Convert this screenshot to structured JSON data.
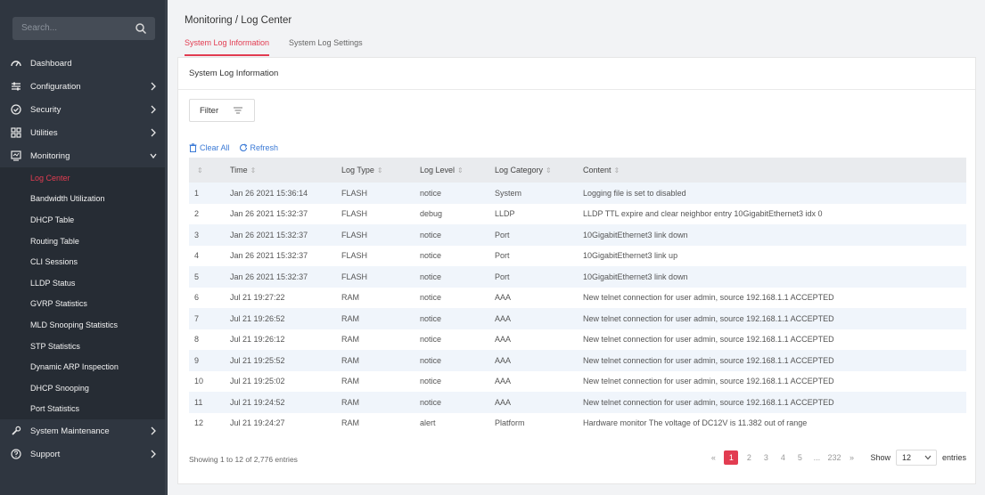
{
  "sidebar": {
    "search_placeholder": "Search...",
    "items": [
      {
        "label": "Dashboard",
        "icon": "dashboard-icon"
      },
      {
        "label": "Configuration",
        "icon": "sliders-icon"
      },
      {
        "label": "Security",
        "icon": "shield-icon"
      },
      {
        "label": "Utilities",
        "icon": "grid-icon"
      },
      {
        "label": "Monitoring",
        "icon": "monitor-icon"
      }
    ],
    "monitoring_sub": [
      "Log Center",
      "Bandwidth Utilization",
      "DHCP Table",
      "Routing Table",
      "CLI Sessions",
      "LLDP Status",
      "GVRP Statistics",
      "MLD Snooping Statistics",
      "STP Statistics",
      "Dynamic ARP Inspection",
      "DHCP Snooping",
      "Port Statistics"
    ],
    "bottom_items": [
      {
        "label": "System Maintenance",
        "icon": "wrench-icon"
      },
      {
        "label": "Support",
        "icon": "help-icon"
      }
    ]
  },
  "header": {
    "breadcrumb": "Monitoring / Log Center"
  },
  "tabs": [
    "System Log Information",
    "System Log Settings"
  ],
  "panel": {
    "title": "System Log Information",
    "filter_label": "Filter",
    "clear_all": "Clear All",
    "refresh": "Refresh"
  },
  "table": {
    "columns": [
      "",
      "Time",
      "Log Type",
      "Log Level",
      "Log Category",
      "Content"
    ],
    "rows": [
      [
        "1",
        "Jan 26 2021 15:36:14",
        "FLASH",
        "notice",
        "System",
        "Logging file is set to disabled"
      ],
      [
        "2",
        "Jan 26 2021 15:32:37",
        "FLASH",
        "debug",
        "LLDP",
        "LLDP TTL expire and clear neighbor entry 10GigabitEthernet3 idx 0"
      ],
      [
        "3",
        "Jan 26 2021 15:32:37",
        "FLASH",
        "notice",
        "Port",
        "10GigabitEthernet3 link down"
      ],
      [
        "4",
        "Jan 26 2021 15:32:37",
        "FLASH",
        "notice",
        "Port",
        "10GigabitEthernet3 link up"
      ],
      [
        "5",
        "Jan 26 2021 15:32:37",
        "FLASH",
        "notice",
        "Port",
        "10GigabitEthernet3 link down"
      ],
      [
        "6",
        "Jul 21 19:27:22",
        "RAM",
        "notice",
        "AAA",
        "New telnet connection for user admin, source 192.168.1.1 ACCEPTED"
      ],
      [
        "7",
        "Jul 21 19:26:52",
        "RAM",
        "notice",
        "AAA",
        "New telnet connection for user admin, source 192.168.1.1 ACCEPTED"
      ],
      [
        "8",
        "Jul 21 19:26:12",
        "RAM",
        "notice",
        "AAA",
        "New telnet connection for user admin, source 192.168.1.1 ACCEPTED"
      ],
      [
        "9",
        "Jul 21 19:25:52",
        "RAM",
        "notice",
        "AAA",
        "New telnet connection for user admin, source 192.168.1.1 ACCEPTED"
      ],
      [
        "10",
        "Jul 21 19:25:02",
        "RAM",
        "notice",
        "AAA",
        "New telnet connection for user admin, source 192.168.1.1 ACCEPTED"
      ],
      [
        "11",
        "Jul 21 19:24:52",
        "RAM",
        "notice",
        "AAA",
        "New telnet connection for user admin, source 192.168.1.1 ACCEPTED"
      ],
      [
        "12",
        "Jul 21 19:24:27",
        "RAM",
        "alert",
        "Platform",
        "Hardware monitor The voltage of DC12V is 11.382 out of range"
      ]
    ]
  },
  "footer": {
    "info": "Showing 1 to 12 of 2,776 entries",
    "pages": [
      "1",
      "2",
      "3",
      "4",
      "5",
      "...",
      "232"
    ],
    "prev": "«",
    "next": "»",
    "show_label": "Show",
    "page_size": "12",
    "entries_label": "entries"
  },
  "colors": {
    "accent": "#e23c51",
    "sidebar": "#2f3640",
    "link": "#3b7ad6"
  }
}
